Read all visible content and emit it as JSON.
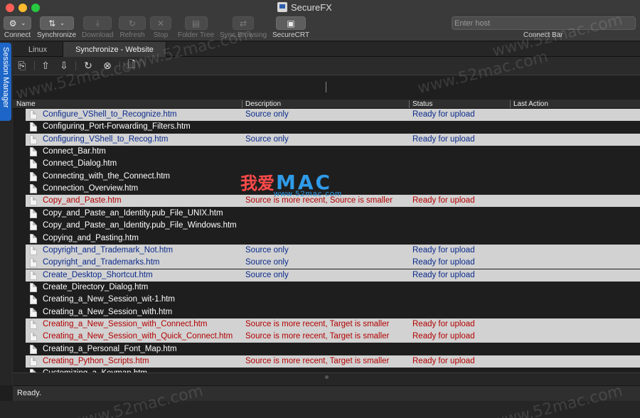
{
  "window": {
    "title": "SecureFX"
  },
  "toolbar": {
    "connect": "Connect",
    "synchronize": "Synchronize",
    "download": "Download",
    "refresh": "Refresh",
    "stop": "Stop",
    "folder_tree": "Folder Tree",
    "sync_browsing": "Sync Browsing",
    "securecrt": "SecureCRT",
    "host_placeholder": "Enter host",
    "connect_bar": "Connect Bar"
  },
  "sidebar": {
    "session_manager": "Session Manager"
  },
  "tabs": [
    {
      "label": "Linux",
      "active": false
    },
    {
      "label": "Synchronize - Website",
      "active": true
    }
  ],
  "table": {
    "columns": [
      "Name",
      "Description",
      "Status",
      "Last Action"
    ],
    "rows": [
      {
        "name": "Configure_VShell_to_Recognize.htm",
        "description": "Source only",
        "status": "Ready for upload"
      },
      {
        "name": "Configuring_Port-Forwarding_Filters.htm",
        "description": "",
        "status": ""
      },
      {
        "name": "Configuring_VShell_to_Recog.htm",
        "description": "Source only",
        "status": "Ready for upload"
      },
      {
        "name": "Connect_Bar.htm",
        "description": "",
        "status": ""
      },
      {
        "name": "Connect_Dialog.htm",
        "description": "",
        "status": ""
      },
      {
        "name": "Connecting_with_the_Connect.htm",
        "description": "",
        "status": ""
      },
      {
        "name": "Connection_Overview.htm",
        "description": "",
        "status": ""
      },
      {
        "name": "Copy_and_Paste.htm",
        "description": "Source is more recent, Source is smaller",
        "status": "Ready for upload"
      },
      {
        "name": "Copy_and_Paste_an_Identity.pub_File_UNIX.htm",
        "description": "",
        "status": ""
      },
      {
        "name": "Copy_and_Paste_an_Identity.pub_File_Windows.htm",
        "description": "",
        "status": ""
      },
      {
        "name": "Copying_and_Pasting.htm",
        "description": "",
        "status": ""
      },
      {
        "name": "Copyright_and_Trademark_Not.htm",
        "description": "Source only",
        "status": "Ready for upload"
      },
      {
        "name": "Copyright_and_Trademarks.htm",
        "description": "Source only",
        "status": "Ready for upload"
      },
      {
        "name": "Create_Desktop_Shortcut.htm",
        "description": "Source only",
        "status": "Ready for upload"
      },
      {
        "name": "Create_Directory_Dialog.htm",
        "description": "",
        "status": ""
      },
      {
        "name": "Creating_a_New_Session_wit-1.htm",
        "description": "",
        "status": ""
      },
      {
        "name": "Creating_a_New_Session_with.htm",
        "description": "",
        "status": ""
      },
      {
        "name": "Creating_a_New_Session_with_Connect.htm",
        "description": "Source is more recent, Target is smaller",
        "status": "Ready for upload"
      },
      {
        "name": "Creating_a_New_Session_with_Quick_Connect.htm",
        "description": "Source is more recent, Target is smaller",
        "status": "Ready for upload"
      },
      {
        "name": "Creating_a_Personal_Font_Map.htm",
        "description": "",
        "status": ""
      },
      {
        "name": "Creating_Python_Scripts.htm",
        "description": "Source is more recent, Target is smaller",
        "status": "Ready for upload"
      },
      {
        "name": "Customizing_a_Keymap.htm",
        "description": "",
        "status": ""
      }
    ]
  },
  "statusbar": {
    "text": "Ready."
  },
  "watermark": {
    "cn": "我爱",
    "mac": "MAC",
    "url": "www.52mac.com",
    "faint": "www.52mac.com"
  },
  "colors": {
    "source_only": "#0a2a8a",
    "more_recent": "#b30000",
    "highlight": "#d2d2d2",
    "session_tab": "#1d66c8"
  }
}
